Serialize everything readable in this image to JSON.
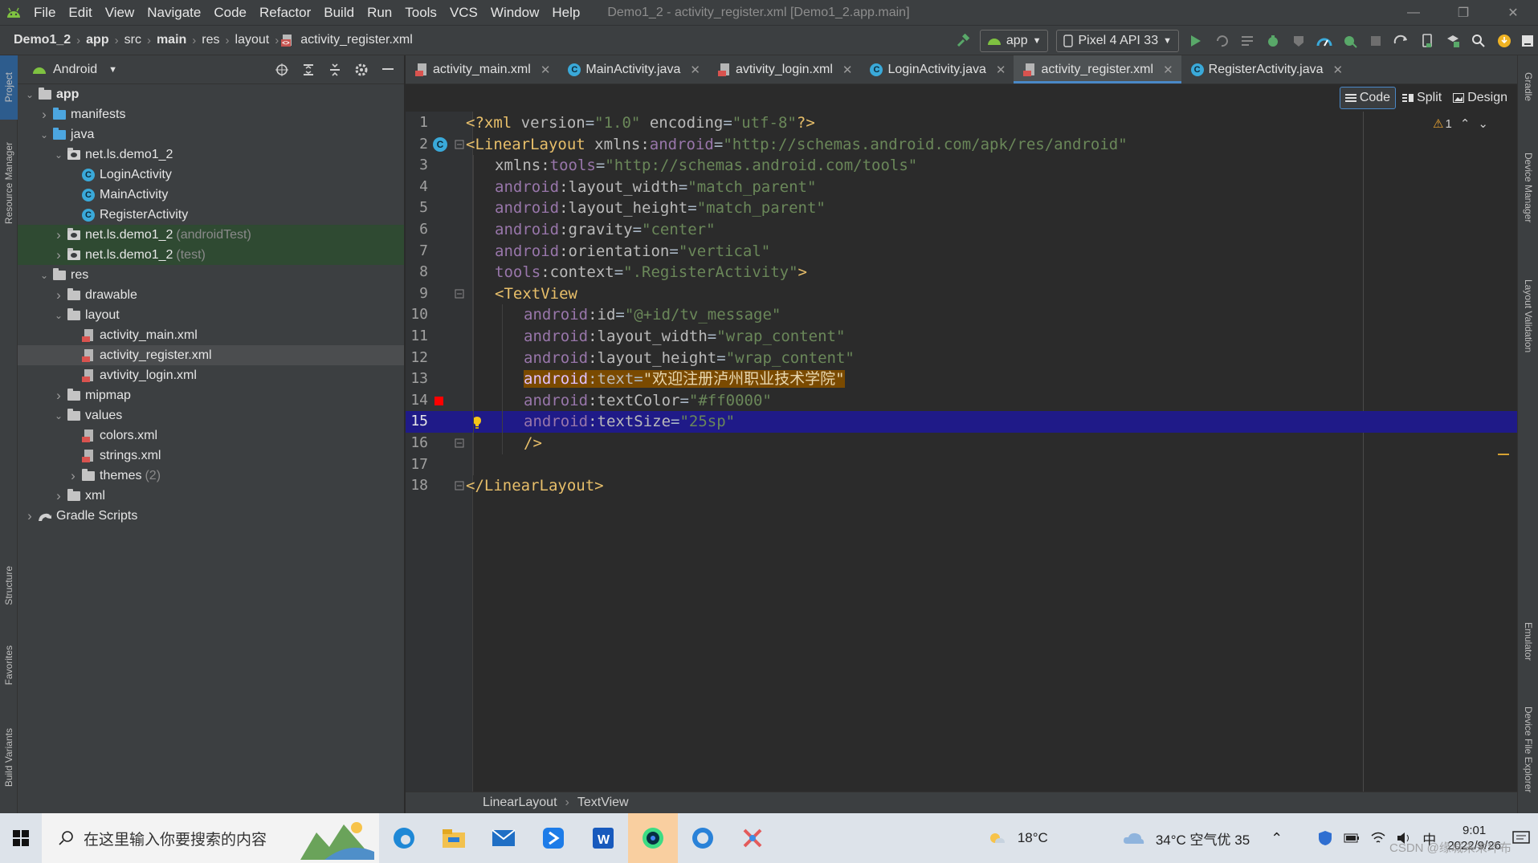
{
  "menubar": {
    "items": [
      "File",
      "Edit",
      "View",
      "Navigate",
      "Code",
      "Refactor",
      "Build",
      "Run",
      "Tools",
      "VCS",
      "Window",
      "Help"
    ],
    "window_title": "Demo1_2 - activity_register.xml [Demo1_2.app.main]",
    "controls": [
      "—",
      "❐",
      "✕"
    ]
  },
  "navbar": {
    "crumbs": [
      "Demo1_2",
      "app",
      "src",
      "main",
      "res",
      "layout",
      "activity_register.xml"
    ],
    "run_config": "app",
    "device": "Pixel 4 API 33"
  },
  "left_stripe": {
    "tabs": [
      "Project",
      "Resource Manager",
      "Structure",
      "Favorites",
      "Build Variants"
    ]
  },
  "right_stripe": {
    "tabs": [
      "Gradle",
      "Device Manager",
      "Layout Validation",
      "Emulator",
      "Device File Explorer"
    ]
  },
  "project": {
    "view": "Android",
    "tree": [
      {
        "label": "app",
        "dim": "",
        "depth": 0,
        "arrow": "open",
        "icon": "module-folder",
        "bold": true
      },
      {
        "label": "manifests",
        "dim": "",
        "depth": 1,
        "arrow": "closed",
        "icon": "folder-blue"
      },
      {
        "label": "java",
        "dim": "",
        "depth": 1,
        "arrow": "open",
        "icon": "folder-blue"
      },
      {
        "label": "net.ls.demo1_2",
        "dim": "",
        "depth": 2,
        "arrow": "open",
        "icon": "package"
      },
      {
        "label": "LoginActivity",
        "dim": "",
        "depth": 3,
        "arrow": "none",
        "icon": "class"
      },
      {
        "label": "MainActivity",
        "dim": "",
        "depth": 3,
        "arrow": "none",
        "icon": "class"
      },
      {
        "label": "RegisterActivity",
        "dim": "",
        "depth": 3,
        "arrow": "none",
        "icon": "class"
      },
      {
        "label": "net.ls.demo1_2",
        "dim": "(androidTest)",
        "depth": 2,
        "arrow": "closed",
        "icon": "package",
        "green": true
      },
      {
        "label": "net.ls.demo1_2",
        "dim": "(test)",
        "depth": 2,
        "arrow": "closed",
        "icon": "package",
        "green": true
      },
      {
        "label": "res",
        "dim": "",
        "depth": 1,
        "arrow": "open",
        "icon": "folder-res"
      },
      {
        "label": "drawable",
        "dim": "",
        "depth": 2,
        "arrow": "closed",
        "icon": "folder"
      },
      {
        "label": "layout",
        "dim": "",
        "depth": 2,
        "arrow": "open",
        "icon": "folder"
      },
      {
        "label": "activity_main.xml",
        "dim": "",
        "depth": 3,
        "arrow": "none",
        "icon": "xml"
      },
      {
        "label": "activity_register.xml",
        "dim": "",
        "depth": 3,
        "arrow": "none",
        "icon": "xml",
        "selected": true
      },
      {
        "label": "avtivity_login.xml",
        "dim": "",
        "depth": 3,
        "arrow": "none",
        "icon": "xml"
      },
      {
        "label": "mipmap",
        "dim": "",
        "depth": 2,
        "arrow": "closed",
        "icon": "folder"
      },
      {
        "label": "values",
        "dim": "",
        "depth": 2,
        "arrow": "open",
        "icon": "folder"
      },
      {
        "label": "colors.xml",
        "dim": "",
        "depth": 3,
        "arrow": "none",
        "icon": "xml"
      },
      {
        "label": "strings.xml",
        "dim": "",
        "depth": 3,
        "arrow": "none",
        "icon": "xml"
      },
      {
        "label": "themes",
        "dim": "(2)",
        "depth": 3,
        "arrow": "closed",
        "icon": "folder"
      },
      {
        "label": "xml",
        "dim": "",
        "depth": 2,
        "arrow": "closed",
        "icon": "folder"
      },
      {
        "label": "Gradle Scripts",
        "dim": "",
        "depth": 0,
        "arrow": "closed",
        "icon": "gradle"
      }
    ]
  },
  "editor_tabs": [
    {
      "label": "activity_main.xml",
      "icon": "xml",
      "active": false
    },
    {
      "label": "MainActivity.java",
      "icon": "class",
      "active": false
    },
    {
      "label": "avtivity_login.xml",
      "icon": "xml",
      "active": false
    },
    {
      "label": "LoginActivity.java",
      "icon": "class",
      "active": false
    },
    {
      "label": "activity_register.xml",
      "icon": "xml",
      "active": true
    },
    {
      "label": "RegisterActivity.java",
      "icon": "class",
      "active": false
    }
  ],
  "view_modes": {
    "code": "Code",
    "split": "Split",
    "design": "Design"
  },
  "inspection": {
    "warnings": "1"
  },
  "code_lines": [
    {
      "n": "1",
      "indent": 0,
      "tokens": [
        [
          "tag",
          "<?xml "
        ],
        [
          "attr",
          "version"
        ],
        [
          "plain",
          "="
        ],
        [
          "val",
          "\"1.0\""
        ],
        [
          "plain",
          " "
        ],
        [
          "attr",
          "encoding"
        ],
        [
          "plain",
          "="
        ],
        [
          "val",
          "\"utf-8\""
        ],
        [
          "tag",
          "?>"
        ]
      ]
    },
    {
      "n": "2",
      "indent": 0,
      "tokens": [
        [
          "tag",
          "<LinearLayout "
        ],
        [
          "attr",
          "xmlns:"
        ],
        [
          "ns",
          "android"
        ],
        [
          "plain",
          "="
        ],
        [
          "val",
          "\"http://schemas.android.com/apk/res/android\""
        ]
      ]
    },
    {
      "n": "3",
      "indent": 1,
      "tokens": [
        [
          "attr",
          "xmlns:"
        ],
        [
          "ns",
          "tools"
        ],
        [
          "plain",
          "="
        ],
        [
          "val",
          "\"http://schemas.android.com/tools\""
        ]
      ]
    },
    {
      "n": "4",
      "indent": 1,
      "tokens": [
        [
          "ns",
          "android"
        ],
        [
          "attr",
          ":layout_width"
        ],
        [
          "plain",
          "="
        ],
        [
          "val",
          "\"match_parent\""
        ]
      ]
    },
    {
      "n": "5",
      "indent": 1,
      "tokens": [
        [
          "ns",
          "android"
        ],
        [
          "attr",
          ":layout_height"
        ],
        [
          "plain",
          "="
        ],
        [
          "val",
          "\"match_parent\""
        ]
      ]
    },
    {
      "n": "6",
      "indent": 1,
      "tokens": [
        [
          "ns",
          "android"
        ],
        [
          "attr",
          ":gravity"
        ],
        [
          "plain",
          "="
        ],
        [
          "val",
          "\"center\""
        ]
      ]
    },
    {
      "n": "7",
      "indent": 1,
      "tokens": [
        [
          "ns",
          "android"
        ],
        [
          "attr",
          ":orientation"
        ],
        [
          "plain",
          "="
        ],
        [
          "val",
          "\"vertical\""
        ]
      ]
    },
    {
      "n": "8",
      "indent": 1,
      "tokens": [
        [
          "ns",
          "tools"
        ],
        [
          "attr",
          ":context"
        ],
        [
          "plain",
          "="
        ],
        [
          "val",
          "\".RegisterActivity\""
        ],
        [
          "tag",
          ">"
        ]
      ]
    },
    {
      "n": "9",
      "indent": 1,
      "tokens": [
        [
          "tag",
          "<TextView"
        ]
      ]
    },
    {
      "n": "10",
      "indent": 2,
      "tokens": [
        [
          "ns",
          "android"
        ],
        [
          "attr",
          ":id"
        ],
        [
          "plain",
          "="
        ],
        [
          "val",
          "\"@+id/tv_message\""
        ]
      ]
    },
    {
      "n": "11",
      "indent": 2,
      "tokens": [
        [
          "ns",
          "android"
        ],
        [
          "attr",
          ":layout_width"
        ],
        [
          "plain",
          "="
        ],
        [
          "val",
          "\"wrap_content\""
        ]
      ]
    },
    {
      "n": "12",
      "indent": 2,
      "tokens": [
        [
          "ns",
          "android"
        ],
        [
          "attr",
          ":layout_height"
        ],
        [
          "plain",
          "="
        ],
        [
          "val",
          "\"wrap_content\""
        ]
      ]
    },
    {
      "n": "13",
      "indent": 2,
      "warn": true,
      "tokens": [
        [
          "ns",
          "android"
        ],
        [
          "attr",
          ":text"
        ],
        [
          "plain",
          "="
        ],
        [
          "val",
          "\"欢迎注册泸州职业技术学院\""
        ]
      ]
    },
    {
      "n": "14",
      "indent": 2,
      "tokens": [
        [
          "ns",
          "android"
        ],
        [
          "attr",
          ":textColor"
        ],
        [
          "plain",
          "="
        ],
        [
          "val",
          "\"#ff0000\""
        ]
      ]
    },
    {
      "n": "15",
      "indent": 2,
      "current": true,
      "tokens": [
        [
          "ns",
          "android"
        ],
        [
          "attr",
          ":textSize"
        ],
        [
          "plain",
          "="
        ],
        [
          "val",
          "\"25sp\""
        ]
      ]
    },
    {
      "n": "16",
      "indent": 2,
      "tokens": [
        [
          "tag",
          "/>"
        ]
      ]
    },
    {
      "n": "17",
      "indent": 0,
      "tokens": []
    },
    {
      "n": "18",
      "indent": 0,
      "tokens": [
        [
          "tag",
          "</LinearLayout>"
        ]
      ]
    }
  ],
  "editor_breadcrumb": [
    "LinearLayout",
    "TextView"
  ],
  "taskbar": {
    "search_placeholder": "在这里输入你要搜索的内容",
    "weather_temp": "18°C",
    "air": "34°C  空气优 35",
    "ime": "中",
    "time": "9:01",
    "date": "2022/9/26",
    "watermark": "CSDN @缘城未末坏布"
  },
  "colors": {
    "accent": "#4a88c7",
    "current_line": "#1f1a88",
    "tag": "#e8bf6a",
    "namespace": "#9876aa",
    "value": "#6a8759",
    "warning_bg": "#7a4a00"
  }
}
